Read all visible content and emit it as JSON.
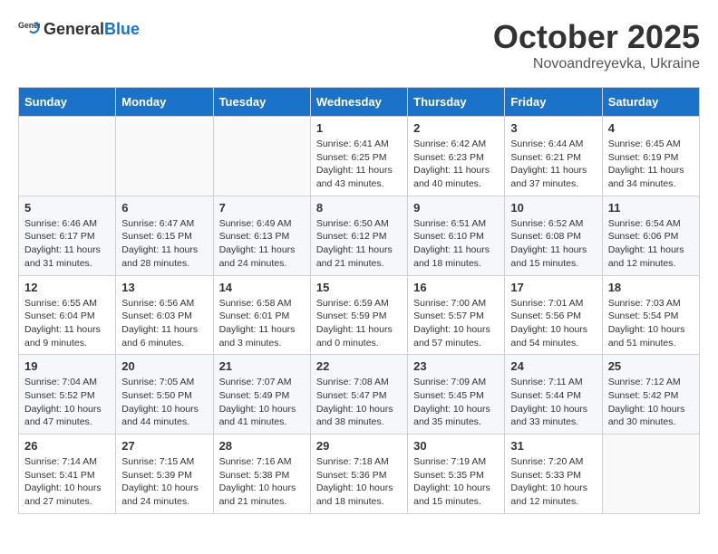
{
  "header": {
    "logo_general": "General",
    "logo_blue": "Blue",
    "month": "October 2025",
    "location": "Novoandreyevka, Ukraine"
  },
  "weekdays": [
    "Sunday",
    "Monday",
    "Tuesday",
    "Wednesday",
    "Thursday",
    "Friday",
    "Saturday"
  ],
  "weeks": [
    [
      {
        "day": "",
        "info": ""
      },
      {
        "day": "",
        "info": ""
      },
      {
        "day": "",
        "info": ""
      },
      {
        "day": "1",
        "info": "Sunrise: 6:41 AM\nSunset: 6:25 PM\nDaylight: 11 hours\nand 43 minutes."
      },
      {
        "day": "2",
        "info": "Sunrise: 6:42 AM\nSunset: 6:23 PM\nDaylight: 11 hours\nand 40 minutes."
      },
      {
        "day": "3",
        "info": "Sunrise: 6:44 AM\nSunset: 6:21 PM\nDaylight: 11 hours\nand 37 minutes."
      },
      {
        "day": "4",
        "info": "Sunrise: 6:45 AM\nSunset: 6:19 PM\nDaylight: 11 hours\nand 34 minutes."
      }
    ],
    [
      {
        "day": "5",
        "info": "Sunrise: 6:46 AM\nSunset: 6:17 PM\nDaylight: 11 hours\nand 31 minutes."
      },
      {
        "day": "6",
        "info": "Sunrise: 6:47 AM\nSunset: 6:15 PM\nDaylight: 11 hours\nand 28 minutes."
      },
      {
        "day": "7",
        "info": "Sunrise: 6:49 AM\nSunset: 6:13 PM\nDaylight: 11 hours\nand 24 minutes."
      },
      {
        "day": "8",
        "info": "Sunrise: 6:50 AM\nSunset: 6:12 PM\nDaylight: 11 hours\nand 21 minutes."
      },
      {
        "day": "9",
        "info": "Sunrise: 6:51 AM\nSunset: 6:10 PM\nDaylight: 11 hours\nand 18 minutes."
      },
      {
        "day": "10",
        "info": "Sunrise: 6:52 AM\nSunset: 6:08 PM\nDaylight: 11 hours\nand 15 minutes."
      },
      {
        "day": "11",
        "info": "Sunrise: 6:54 AM\nSunset: 6:06 PM\nDaylight: 11 hours\nand 12 minutes."
      }
    ],
    [
      {
        "day": "12",
        "info": "Sunrise: 6:55 AM\nSunset: 6:04 PM\nDaylight: 11 hours\nand 9 minutes."
      },
      {
        "day": "13",
        "info": "Sunrise: 6:56 AM\nSunset: 6:03 PM\nDaylight: 11 hours\nand 6 minutes."
      },
      {
        "day": "14",
        "info": "Sunrise: 6:58 AM\nSunset: 6:01 PM\nDaylight: 11 hours\nand 3 minutes."
      },
      {
        "day": "15",
        "info": "Sunrise: 6:59 AM\nSunset: 5:59 PM\nDaylight: 11 hours\nand 0 minutes."
      },
      {
        "day": "16",
        "info": "Sunrise: 7:00 AM\nSunset: 5:57 PM\nDaylight: 10 hours\nand 57 minutes."
      },
      {
        "day": "17",
        "info": "Sunrise: 7:01 AM\nSunset: 5:56 PM\nDaylight: 10 hours\nand 54 minutes."
      },
      {
        "day": "18",
        "info": "Sunrise: 7:03 AM\nSunset: 5:54 PM\nDaylight: 10 hours\nand 51 minutes."
      }
    ],
    [
      {
        "day": "19",
        "info": "Sunrise: 7:04 AM\nSunset: 5:52 PM\nDaylight: 10 hours\nand 47 minutes."
      },
      {
        "day": "20",
        "info": "Sunrise: 7:05 AM\nSunset: 5:50 PM\nDaylight: 10 hours\nand 44 minutes."
      },
      {
        "day": "21",
        "info": "Sunrise: 7:07 AM\nSunset: 5:49 PM\nDaylight: 10 hours\nand 41 minutes."
      },
      {
        "day": "22",
        "info": "Sunrise: 7:08 AM\nSunset: 5:47 PM\nDaylight: 10 hours\nand 38 minutes."
      },
      {
        "day": "23",
        "info": "Sunrise: 7:09 AM\nSunset: 5:45 PM\nDaylight: 10 hours\nand 35 minutes."
      },
      {
        "day": "24",
        "info": "Sunrise: 7:11 AM\nSunset: 5:44 PM\nDaylight: 10 hours\nand 33 minutes."
      },
      {
        "day": "25",
        "info": "Sunrise: 7:12 AM\nSunset: 5:42 PM\nDaylight: 10 hours\nand 30 minutes."
      }
    ],
    [
      {
        "day": "26",
        "info": "Sunrise: 7:14 AM\nSunset: 5:41 PM\nDaylight: 10 hours\nand 27 minutes."
      },
      {
        "day": "27",
        "info": "Sunrise: 7:15 AM\nSunset: 5:39 PM\nDaylight: 10 hours\nand 24 minutes."
      },
      {
        "day": "28",
        "info": "Sunrise: 7:16 AM\nSunset: 5:38 PM\nDaylight: 10 hours\nand 21 minutes."
      },
      {
        "day": "29",
        "info": "Sunrise: 7:18 AM\nSunset: 5:36 PM\nDaylight: 10 hours\nand 18 minutes."
      },
      {
        "day": "30",
        "info": "Sunrise: 7:19 AM\nSunset: 5:35 PM\nDaylight: 10 hours\nand 15 minutes."
      },
      {
        "day": "31",
        "info": "Sunrise: 7:20 AM\nSunset: 5:33 PM\nDaylight: 10 hours\nand 12 minutes."
      },
      {
        "day": "",
        "info": ""
      }
    ]
  ]
}
